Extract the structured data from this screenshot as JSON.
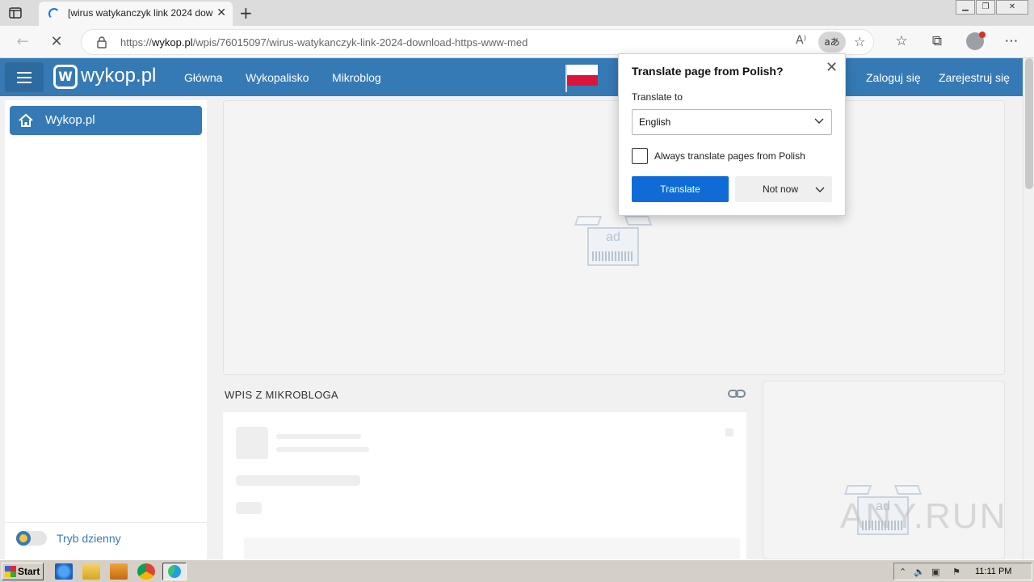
{
  "browser": {
    "tab_title": "[wirus watykanczyk link 2024 dow",
    "url_prefix": "https://",
    "url_host": "wykop.pl",
    "url_path": "/wpis/76015097/wirus-watykanczyk-link-2024-download-https-www-med",
    "translate_icon_text": "aあ"
  },
  "site": {
    "logo_text": "wykop.pl",
    "logo_mark": "W",
    "nav": [
      "Główna",
      "Wykopalisko",
      "Mikroblog"
    ],
    "login": "Zaloguj się",
    "register": "Zarejestruj się",
    "brand_color": "#367ab5"
  },
  "sidebar": {
    "home_label": "Wykop.pl",
    "theme_toggle_label": "Tryb dzienny"
  },
  "ads": {
    "ad_label": "ad"
  },
  "main": {
    "section_title": "WPIS Z MIKROBLOGA"
  },
  "translate_popup": {
    "title": "Translate page from Polish?",
    "translate_to_label": "Translate to",
    "selected_language": "English",
    "always_translate_label": "Always translate pages from Polish",
    "always_translate_checked": false,
    "translate_button": "Translate",
    "not_now_button": "Not now",
    "primary_color": "#0f6cd6"
  },
  "watermark": "ANY.RUN",
  "taskbar": {
    "start_label": "Start",
    "clock": "11:11 PM"
  }
}
